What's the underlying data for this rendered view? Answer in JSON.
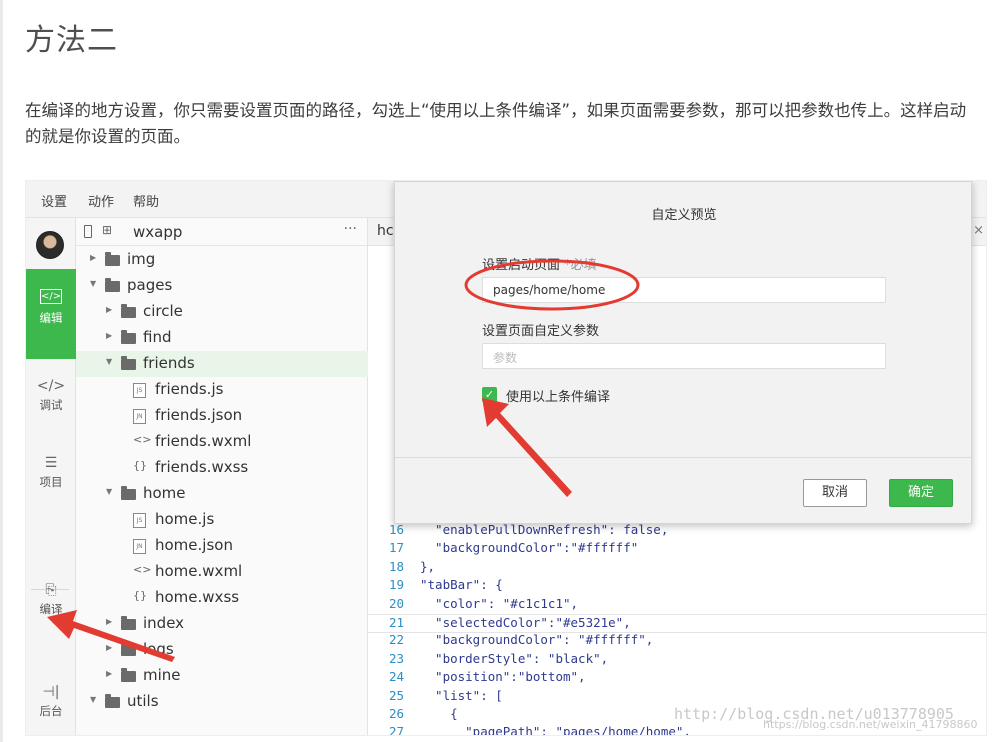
{
  "article": {
    "heading": "方法二",
    "paragraph": "在编译的地方设置，你只需要设置页面的路径，勾选上“使用以上条件编译”，如果页面需要参数，那可以把参数也传上。这样启动的就是你设置的页面。"
  },
  "menubar": [
    "设置",
    "动作",
    "帮助"
  ],
  "sidebar": {
    "items": [
      {
        "icon": "code-icon",
        "glyph": "</>",
        "label": "编辑"
      },
      {
        "icon": "debug-icon",
        "glyph": "</>",
        "label": "调试"
      },
      {
        "icon": "list-icon",
        "glyph": "☰",
        "label": "项目"
      },
      {
        "icon": "compile-icon",
        "glyph": "⎘",
        "label": "编译"
      },
      {
        "icon": "backend-icon",
        "glyph": "⊣|",
        "label": "后台"
      }
    ]
  },
  "tree": {
    "project": "wxapp",
    "more": "···",
    "items": [
      {
        "name": "img",
        "type": "folder",
        "depth": 0,
        "expanded": false
      },
      {
        "name": "pages",
        "type": "folder",
        "depth": 0,
        "expanded": true
      },
      {
        "name": "circle",
        "type": "folder",
        "depth": 1,
        "expanded": false
      },
      {
        "name": "find",
        "type": "folder",
        "depth": 1,
        "expanded": false
      },
      {
        "name": "friends",
        "type": "folder",
        "depth": 1,
        "expanded": true,
        "selected": true
      },
      {
        "name": "friends.js",
        "type": "js",
        "badge": "JS",
        "depth": 2
      },
      {
        "name": "friends.json",
        "type": "json",
        "badge": "JN",
        "depth": 2
      },
      {
        "name": "friends.wxml",
        "type": "wxml",
        "badge": "<>",
        "depth": 2
      },
      {
        "name": "friends.wxss",
        "type": "wxss",
        "badge": "{}",
        "depth": 2
      },
      {
        "name": "home",
        "type": "folder",
        "depth": 1,
        "expanded": true
      },
      {
        "name": "home.js",
        "type": "js",
        "badge": "JS",
        "depth": 2
      },
      {
        "name": "home.json",
        "type": "json",
        "badge": "JN",
        "depth": 2
      },
      {
        "name": "home.wxml",
        "type": "wxml",
        "badge": "<>",
        "depth": 2
      },
      {
        "name": "home.wxss",
        "type": "wxss",
        "badge": "{}",
        "depth": 2
      },
      {
        "name": "index",
        "type": "folder",
        "depth": 1,
        "expanded": false
      },
      {
        "name": "logs",
        "type": "folder",
        "depth": 1,
        "expanded": false
      },
      {
        "name": "mine",
        "type": "folder",
        "depth": 1,
        "expanded": false
      },
      {
        "name": "utils",
        "type": "folder",
        "depth": 0,
        "expanded": true
      }
    ]
  },
  "editor": {
    "tab": "hc",
    "close": "×",
    "lines": [
      {
        "n": "16",
        "text": "  \"enablePullDownRefresh\": false,"
      },
      {
        "n": "17",
        "text": "  \"backgroundColor\":\"#ffffff\""
      },
      {
        "n": "18",
        "text": "},"
      },
      {
        "n": "19",
        "text": "\"tabBar\": {"
      },
      {
        "n": "20",
        "text": "  \"color\": \"#c1c1c1\","
      },
      {
        "n": "21",
        "text": "  \"selectedColor\":\"#e5321e\",",
        "highlight": true
      },
      {
        "n": "22",
        "text": "  \"backgroundColor\": \"#ffffff\","
      },
      {
        "n": "23",
        "text": "  \"borderStyle\": \"black\","
      },
      {
        "n": "24",
        "text": "  \"position\":\"bottom\","
      },
      {
        "n": "25",
        "text": "  \"list\": ["
      },
      {
        "n": "26",
        "text": "    {"
      },
      {
        "n": "27",
        "text": "      \"pagePath\": \"pages/home/home\","
      }
    ],
    "watermark": "http://blog.csdn.net/u013778905",
    "watermark2": "https://blog.csdn.net/weixin_41798860"
  },
  "dialog": {
    "title": "自定义预览",
    "start_page_label": "设置启动页面",
    "required": "*必填",
    "start_page_value": "pages/home/home",
    "params_label": "设置页面自定义参数",
    "params_placeholder": "参数",
    "checkbox_checked": true,
    "checkbox_label": "使用以上条件编译",
    "cancel": "取消",
    "ok": "确定"
  },
  "colors": {
    "accent": "#3cb84d",
    "annotation_red": "#e23b32"
  }
}
